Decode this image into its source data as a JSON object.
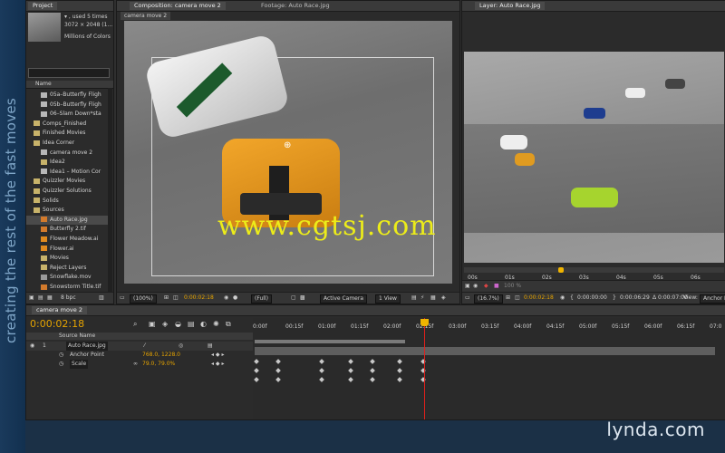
{
  "side_caption": "creating the rest of the fast moves",
  "watermark": "www.cgtsj.com",
  "brand": "lynda.com",
  "project": {
    "tab": "Project",
    "info": [
      "▾ , used 5 times",
      "3072 × 2048 (1...",
      "Millions of Colors"
    ],
    "col_name": "Name",
    "items": [
      {
        "label": "05a–Butterfly Fligh",
        "icon": "comp-icon",
        "indent": 16
      },
      {
        "label": "05b–Butterfly Fligh",
        "icon": "comp-icon",
        "indent": 16
      },
      {
        "label": "06–Slam Down*sta",
        "icon": "comp-icon",
        "indent": 16
      },
      {
        "label": "Comps_Finished",
        "icon": "folder-icon",
        "indent": 8
      },
      {
        "label": "Finished Movies",
        "icon": "folder-icon",
        "indent": 8
      },
      {
        "label": "Idea Corner",
        "icon": "folder-icon",
        "indent": 8
      },
      {
        "label": "camera move 2",
        "icon": "comp-icon",
        "indent": 16
      },
      {
        "label": "Idea2",
        "icon": "folder-icon",
        "indent": 16
      },
      {
        "label": "Idea1 – Motion Cor",
        "icon": "comp-icon",
        "indent": 16
      },
      {
        "label": "Quizzler Movies",
        "icon": "folder-icon",
        "indent": 8
      },
      {
        "label": "Quizzler Solutions",
        "icon": "folder-icon",
        "indent": 8
      },
      {
        "label": "Solids",
        "icon": "folder-icon",
        "indent": 8
      },
      {
        "label": "Sources",
        "icon": "folder-icon",
        "indent": 8
      },
      {
        "label": "Auto Race.jpg",
        "icon": "image-icon",
        "indent": 16,
        "selected": true
      },
      {
        "label": "Butterfly 2.tif",
        "icon": "image-icon",
        "indent": 16
      },
      {
        "label": "Flower Meadow.ai",
        "icon": "ai-icon",
        "indent": 16
      },
      {
        "label": "Flower.ai",
        "icon": "ai-icon",
        "indent": 16
      },
      {
        "label": "Movies",
        "icon": "folder-icon",
        "indent": 16
      },
      {
        "label": "Reject Layers",
        "icon": "folder-icon",
        "indent": 16
      },
      {
        "label": "Snowflake.mov",
        "icon": "movie-icon",
        "indent": 16
      },
      {
        "label": "Snowstorm Title.tif",
        "icon": "image-icon",
        "indent": 16
      }
    ],
    "bpc": "8 bpc"
  },
  "composition": {
    "tab": "Composition: camera move 2",
    "tab2": "Footage: Auto Race.jpg",
    "subtab": "camera move 2",
    "zoom": "(100%)",
    "time": "0:00:02:18",
    "resolution": "(Full)",
    "camera": "Active Camera",
    "view": "1 View"
  },
  "layer_panel": {
    "tab": "Layer: Auto Race.jpg",
    "ruler": [
      "00s",
      "01s",
      "02s",
      "03s",
      "04s",
      "05s",
      "06s"
    ],
    "zoom": "(16.7%)",
    "percent": "100 %",
    "time": "0:00:02:18",
    "in": "0:00:00:00",
    "out": "0:00:06:29",
    "duration": "Δ 0:00:07:00",
    "view_label": "View:",
    "view_value": "Anchor P"
  },
  "timeline": {
    "tab": "camera move 2",
    "time": "0:00:02:18",
    "col_source": "Source Name",
    "marks": [
      "0:00f",
      "00:15f",
      "01:00f",
      "01:15f",
      "02:00f",
      "02:15f",
      "03:00f",
      "03:15f",
      "04:00f",
      "04:15f",
      "05:00f",
      "05:15f",
      "06:00f",
      "06:15f",
      "07:0"
    ],
    "layer": {
      "num": "1",
      "name": "Auto Race.jpg"
    },
    "props": [
      {
        "name": "Anchor Point",
        "value": "768.0, 1228.0"
      },
      {
        "name": "Scale",
        "value": "79.0, 79.0%"
      }
    ],
    "playhead_fraction": 0.37
  }
}
